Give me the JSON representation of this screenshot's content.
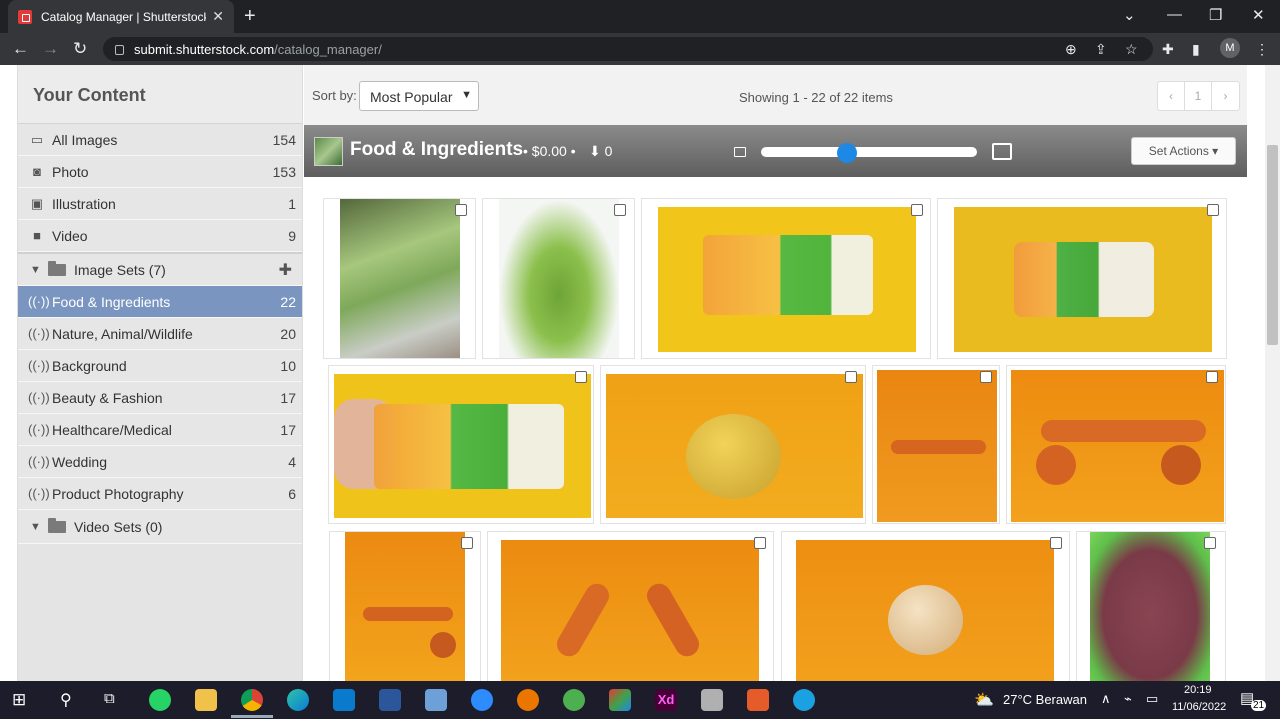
{
  "browser": {
    "tab_title": "Catalog Manager | Shutterstock",
    "url_host": "submit.shutterstock.com",
    "url_path": "/catalog_manager/",
    "profile_initial": "M"
  },
  "sidebar": {
    "heading": "Your Content",
    "items": [
      {
        "label": "All Images",
        "count": "154",
        "icon": "book-icon"
      },
      {
        "label": "Photo",
        "count": "153",
        "icon": "camera-icon"
      },
      {
        "label": "Illustration",
        "count": "1",
        "icon": "picture-icon"
      },
      {
        "label": "Video",
        "count": "9",
        "icon": "video-camera-icon"
      }
    ],
    "image_sets_label": "Image Sets (7)",
    "sets": [
      {
        "label": "Food & Ingredients",
        "count": "22",
        "active": true
      },
      {
        "label": "Nature, Animal/Wildlife",
        "count": "20"
      },
      {
        "label": "Background",
        "count": "10"
      },
      {
        "label": "Beauty & Fashion",
        "count": "17"
      },
      {
        "label": "Healthcare/Medical",
        "count": "17"
      },
      {
        "label": "Wedding",
        "count": "4"
      },
      {
        "label": "Product Photography",
        "count": "6"
      }
    ],
    "video_sets_label": "Video Sets (0)"
  },
  "toolbar": {
    "sort_label": "Sort by:",
    "sort_value": "Most Popular",
    "showing": "Showing 1 - 22 of 22 items",
    "page": "1",
    "prev": "‹",
    "next": "›"
  },
  "set_header": {
    "title": "Food & Ingredients",
    "earnings": "• $0.00 •",
    "downloads": "0",
    "set_actions": "Set Actions ▾",
    "thumbnail_size_level": 0.4
  },
  "colors": {
    "accent": "#7a96c0",
    "knob": "#1e88e5"
  },
  "taskbar": {
    "weather": "27°C  Berawan",
    "time": "20:19",
    "date": "11/06/2022",
    "notifications": "21"
  }
}
